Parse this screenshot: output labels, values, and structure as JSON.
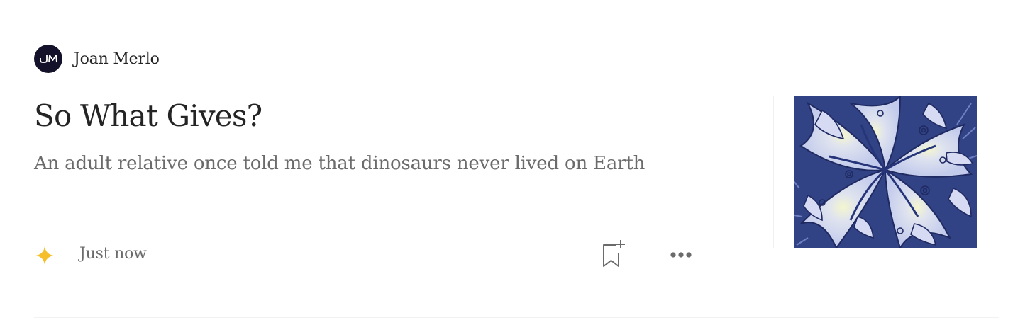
{
  "author": {
    "name": "Joan Merlo",
    "initials": "JM"
  },
  "story": {
    "title": "So What Gives?",
    "subtitle": "An adult relative once told me that dinosaurs never lived on Earth",
    "timestamp": "Just now",
    "thumbnail_icon": "abstract-swirl-artwork"
  },
  "actions": {
    "save_icon": "bookmark-add-icon",
    "more_icon": "more-horizontal-icon",
    "member_icon": "sparkle-icon"
  },
  "colors": {
    "avatar_bg": "#14122a",
    "sparkle": "#f5be2b",
    "text_primary": "#242424",
    "text_secondary": "#6b6b6b",
    "thumb_dark": "#2b3a7a",
    "thumb_light": "#c9d0ee",
    "thumb_center": "#eef2c8"
  }
}
